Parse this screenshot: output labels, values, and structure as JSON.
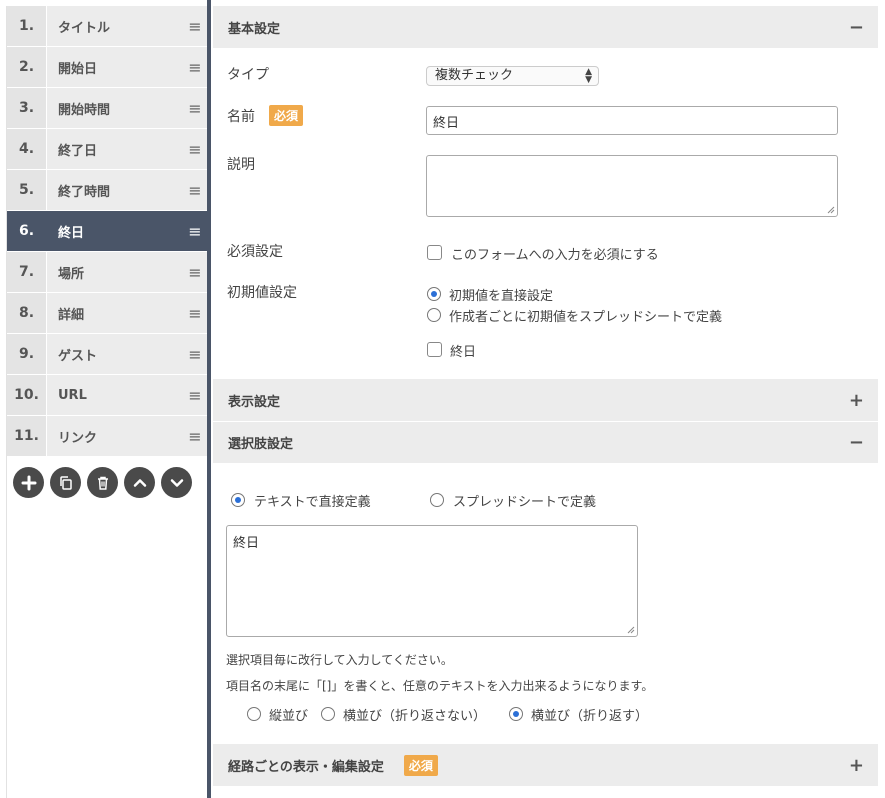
{
  "sidebar": {
    "items": [
      {
        "num": "1.",
        "label": "タイトル"
      },
      {
        "num": "2.",
        "label": "開始日"
      },
      {
        "num": "3.",
        "label": "開始時間"
      },
      {
        "num": "4.",
        "label": "終了日"
      },
      {
        "num": "5.",
        "label": "終了時間"
      },
      {
        "num": "6.",
        "label": "終日"
      },
      {
        "num": "7.",
        "label": "場所"
      },
      {
        "num": "8.",
        "label": "詳細"
      },
      {
        "num": "9.",
        "label": "ゲスト"
      },
      {
        "num": "10.",
        "label": "URL"
      },
      {
        "num": "11.",
        "label": "リンク"
      }
    ],
    "active_index": 5,
    "tools": [
      "plus-icon",
      "copy-icon",
      "trash-icon",
      "chevron-up-icon",
      "chevron-down-icon"
    ]
  },
  "basic": {
    "title": "基本設定",
    "toggle": "−",
    "type_label": "タイプ",
    "type_value": "複数チェック",
    "name_label": "名前",
    "required_badge": "必須",
    "name_value": "終日",
    "desc_label": "説明",
    "desc_value": "",
    "required_label": "必須設定",
    "required_checkbox": "このフォームへの入力を必須にする",
    "initial_label": "初期値設定",
    "initial_opt1": "初期値を直接設定",
    "initial_opt2": "作成者ごとに初期値をスプレッドシートで定義",
    "initial_checkbox": "終日"
  },
  "display": {
    "title": "表示設定",
    "toggle": "+"
  },
  "choices": {
    "title": "選択肢設定",
    "toggle": "−",
    "source_opt1": "テキストで直接定義",
    "source_opt2": "スプレッドシートで定義",
    "text_value": "終日",
    "help1": "選択項目毎に改行して入力してください。",
    "help2": "項目名の末尾に「[]」を書くと、任意のテキストを入力出来るようになります。",
    "layout_opt1": "縦並び",
    "layout_opt2": "横並び（折り返さない）",
    "layout_opt3": "横並び（折り返す）"
  },
  "route": {
    "title": "経路ごとの表示・編集設定",
    "required_badge": "必須",
    "toggle": "+"
  },
  "colors": {
    "active": "#4a5568",
    "badge": "#f0a94a",
    "radio_selected": "#2b6fd6"
  }
}
